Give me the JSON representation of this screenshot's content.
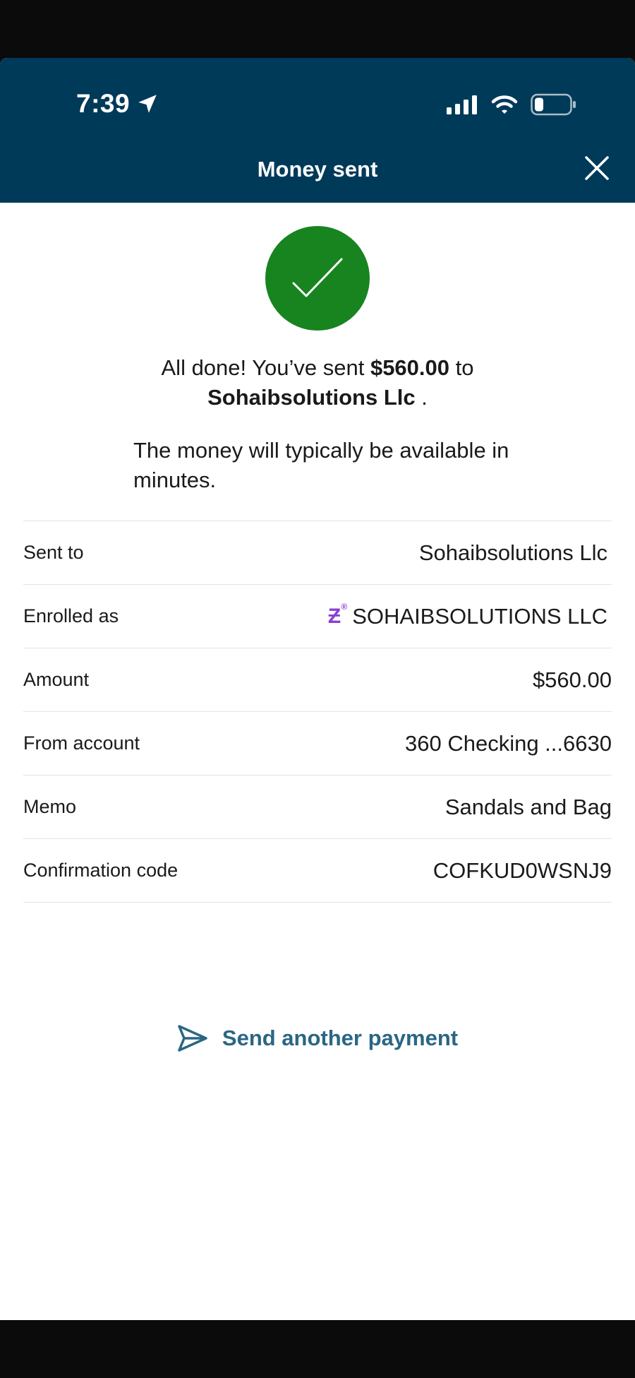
{
  "status_bar": {
    "time": "7:39"
  },
  "header": {
    "title": "Money sent"
  },
  "confirmation": {
    "line1_prefix": "All done! You’ve sent ",
    "amount": "$560.00",
    "line1_suffix": " to",
    "recipient": "Sohaibsolutions Llc",
    "recipient_suffix": " .",
    "availability": "The money will typically be available in minutes."
  },
  "details": [
    {
      "label": "Sent to",
      "value": "Sohaibsolutions Llc"
    },
    {
      "label": "Enrolled as",
      "value": "SOHAIBSOLUTIONS LLC",
      "icon": "zelle-icon"
    },
    {
      "label": "Amount",
      "value": "$560.00"
    },
    {
      "label": "From account",
      "value": "360 Checking ...6630"
    },
    {
      "label": "Memo",
      "value": "Sandals and Bag"
    },
    {
      "label": "Confirmation code",
      "value": "COFKUD0WSNJ9"
    }
  ],
  "actions": {
    "send_another": "Send another payment"
  },
  "colors": {
    "header_bg": "#003a59",
    "success_green": "#17841f",
    "link_blue": "#2b6684",
    "zelle_purple": "#8f3fd1"
  }
}
